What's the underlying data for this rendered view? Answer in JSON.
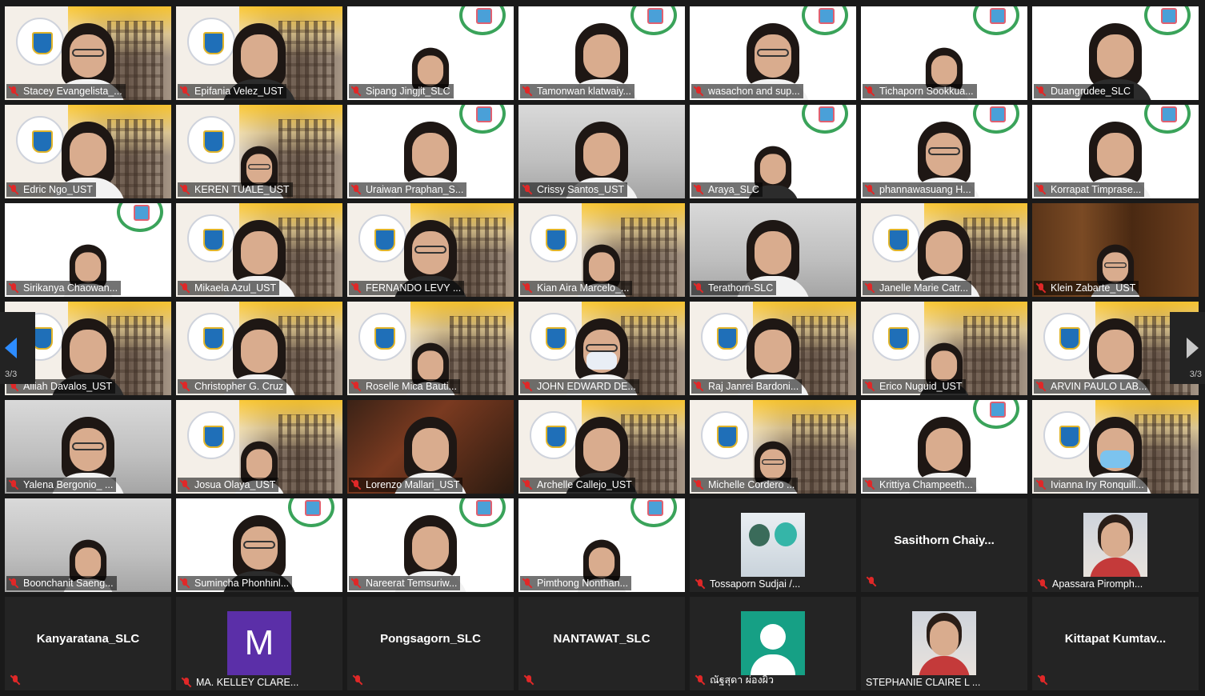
{
  "gallery": {
    "page_indicator_left": "3/3",
    "page_indicator_right": "3/3",
    "tiles": [
      {
        "name": "Stacey Evangelista_...",
        "bg": "campus"
      },
      {
        "name": "Epifania Velez_UST",
        "bg": "campus"
      },
      {
        "name": "Sipang Jingjit_SLC",
        "bg": "white"
      },
      {
        "name": "Tamonwan klatwaiy...",
        "bg": "white"
      },
      {
        "name": "wasachon and sup...",
        "bg": "white"
      },
      {
        "name": "Tichaporn Sookkua...",
        "bg": "white"
      },
      {
        "name": "Duangrudee_SLC",
        "bg": "white"
      },
      {
        "name": "Edric Ngo_UST",
        "bg": "campus"
      },
      {
        "name": "KEREN TUALE_UST",
        "bg": "campus"
      },
      {
        "name": "Uraiwan Praphan_S...",
        "bg": "white"
      },
      {
        "name": "Crissy Santos_UST",
        "bg": "room"
      },
      {
        "name": "Araya_SLC",
        "bg": "white"
      },
      {
        "name": "phannawasuang H...",
        "bg": "white"
      },
      {
        "name": "Korrapat Timprase...",
        "bg": "white"
      },
      {
        "name": "Sirikanya Chaowan...",
        "bg": "white"
      },
      {
        "name": "Mikaela Azul_UST",
        "bg": "campus"
      },
      {
        "name": "FERNANDO LEVY ...",
        "bg": "campus"
      },
      {
        "name": "Kian Aira Marcelo_...",
        "bg": "campus"
      },
      {
        "name": "Terathorn-SLC",
        "bg": "room"
      },
      {
        "name": "Janelle Marie Catr...",
        "bg": "campus"
      },
      {
        "name": "Klein Zabarte_UST",
        "bg": "wood"
      },
      {
        "name": "Alliah Davalos_UST",
        "bg": "campus"
      },
      {
        "name": "Christopher G. Cruz",
        "bg": "campus"
      },
      {
        "name": "Roselle Mica Bauti...",
        "bg": "campus"
      },
      {
        "name": "JOHN EDWARD DE...",
        "bg": "campus"
      },
      {
        "name": "Raj Janrei Bardoni...",
        "bg": "campus"
      },
      {
        "name": "Erico Nuguid_UST",
        "bg": "campus"
      },
      {
        "name": "ARVIN PAULO LAB...",
        "bg": "campus"
      },
      {
        "name": "Yalena Bergonio_ ...",
        "bg": "room"
      },
      {
        "name": "Josua Olaya_UST",
        "bg": "campus"
      },
      {
        "name": "Lorenzo Mallari_UST",
        "bg": "ornate"
      },
      {
        "name": "Archelle Callejo_UST",
        "bg": "campus"
      },
      {
        "name": "Michelle Cordero ...",
        "bg": "campus"
      },
      {
        "name": "Krittiya Champeeth...",
        "bg": "white"
      },
      {
        "name": "Ivianna Iry Ronquill...",
        "bg": "campus"
      },
      {
        "name": "Boonchanit Saeng...",
        "bg": "room"
      },
      {
        "name": "Sumincha Phonhinl...",
        "bg": "white"
      },
      {
        "name": "Nareerat Temsuriw...",
        "bg": "white"
      },
      {
        "name": "Pimthong Nonthan...",
        "bg": "white"
      },
      {
        "name": "Tossaporn Sudjai /...",
        "bg": "avatar-figure"
      },
      {
        "name": "Sasithorn  Chaiy...",
        "bg": "name-only"
      },
      {
        "name": "Apassara Piromph...",
        "bg": "avatar-photo"
      },
      {
        "name": "Kanyaratana_SLC",
        "bg": "name-only"
      },
      {
        "name": "MA. KELLEY CLARE...",
        "bg": "avatar-letter",
        "letter": "M"
      },
      {
        "name": "Pongsagorn_SLC",
        "bg": "name-only"
      },
      {
        "name": "NANTAWAT_SLC",
        "bg": "name-only"
      },
      {
        "name": "ณัฐสุดา ผ่องผิว",
        "bg": "avatar-default"
      },
      {
        "name": "STEPHANIE CLAIRE L ...",
        "bg": "avatar-photo",
        "unmuted": true
      },
      {
        "name": "Kittapat  Kumtav...",
        "bg": "name-only"
      }
    ]
  },
  "colors": {
    "accent": "#2d8cff",
    "muted_mic": "#e02828",
    "avatar_letter_bg": "#5b2fa8",
    "avatar_default_bg": "#16a085"
  }
}
